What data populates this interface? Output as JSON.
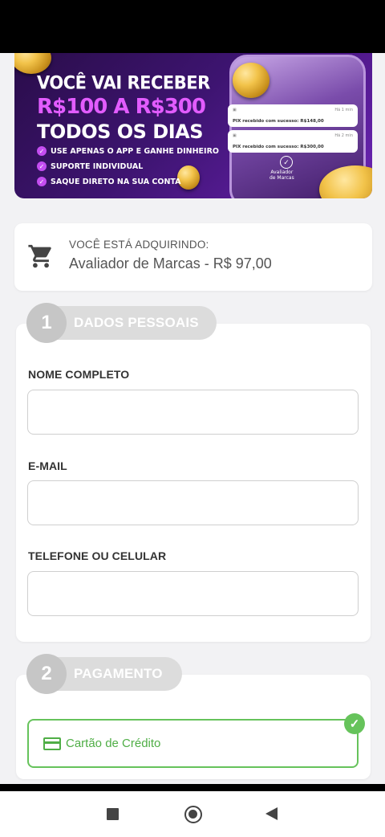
{
  "banner": {
    "headline": "VOCÊ VAI RECEBER",
    "amount": "R$100 A R$300",
    "daily": "TODOS OS DIAS",
    "bullets": [
      "USE APENAS O APP E GANHE DINHEIRO",
      "SUPORTE INDIVIDUAL",
      "SAQUE DIRETO NA SUA CONTA"
    ],
    "notifications": [
      {
        "time": "Há 1 min",
        "text": "PIX recebido com sucesso: R$148,00"
      },
      {
        "time": "Há 2 min",
        "text": "PIX recebido com sucesso: R$300,00"
      }
    ],
    "phone_caption_1": "Avaliador",
    "phone_caption_2": "de Marcas",
    "colors": {
      "accent": "#e25cff",
      "background": "#3d1470"
    }
  },
  "product": {
    "icon": "cart-icon",
    "label": "VOCÊ ESTÁ ADQUIRINDO:",
    "name": "Avaliador de Marcas - R$ 97,00"
  },
  "personal": {
    "step": "1",
    "title": "DADOS PESSOAIS",
    "fields": {
      "name": {
        "label": "NOME COMPLETO",
        "value": "",
        "placeholder": ""
      },
      "email": {
        "label": "E-MAIL",
        "value": "",
        "placeholder": ""
      },
      "phone": {
        "label": "TELEFONE OU CELULAR",
        "value": "",
        "placeholder": ""
      }
    }
  },
  "payment": {
    "step": "2",
    "title": "PAGAMENTO",
    "option": {
      "icon": "credit-card-icon",
      "label": "Cartão de Crédito",
      "selected": true,
      "color": "#66c35b"
    }
  },
  "navbar": {
    "icons": [
      "recents-icon",
      "home-icon",
      "back-icon"
    ]
  }
}
